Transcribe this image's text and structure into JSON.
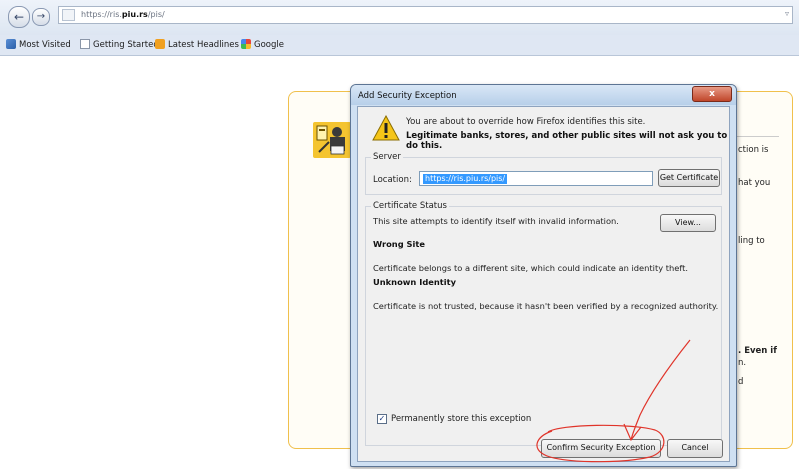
{
  "browser": {
    "url_prefix": "https://ris.",
    "url_domain": "piu.rs",
    "url_suffix": "/pis/",
    "back_glyph": "←",
    "forward_glyph": "→",
    "dropdown_glyph": "▿",
    "bookmarks": [
      {
        "label": "Most Visited",
        "icon": "most-visited-icon"
      },
      {
        "label": "Getting Started",
        "icon": "page-icon"
      },
      {
        "label": "Latest Headlines",
        "icon": "rss-feed-icon"
      },
      {
        "label": "Google",
        "icon": "google-icon"
      }
    ]
  },
  "page": {
    "fragments": [
      "ction is",
      "hat you",
      "ling to",
      ". Even if",
      "n.",
      "d"
    ]
  },
  "dialog": {
    "title": "Add Security Exception",
    "close_glyph": "x",
    "intro_line1": "You are about to override how Firefox identifies this site.",
    "intro_line2": "Legitimate banks, stores, and other public sites will not ask you to do this.",
    "server": {
      "legend": "Server",
      "location_label": "Location:",
      "location_value": "https://ris.piu.rs/pis/",
      "get_certificate_label": "Get Certificate"
    },
    "status": {
      "legend": "Certificate Status",
      "summary": "This site attempts to identify itself with invalid information.",
      "view_label": "View...",
      "wrong_site_heading": "Wrong Site",
      "wrong_site_text": "Certificate belongs to a different site, which could indicate an identity theft.",
      "unknown_identity_heading": "Unknown Identity",
      "unknown_identity_text": "Certificate is not trusted, because it hasn't been verified by a recognized authority."
    },
    "permanent_store": {
      "label": "Permanently store this exception",
      "checked": true
    },
    "confirm_label": "Confirm Security Exception",
    "cancel_label": "Cancel"
  },
  "colors": {
    "annotation": "#e0342a",
    "page_panel_border": "#f0c04c",
    "selection": "#3399ff"
  }
}
